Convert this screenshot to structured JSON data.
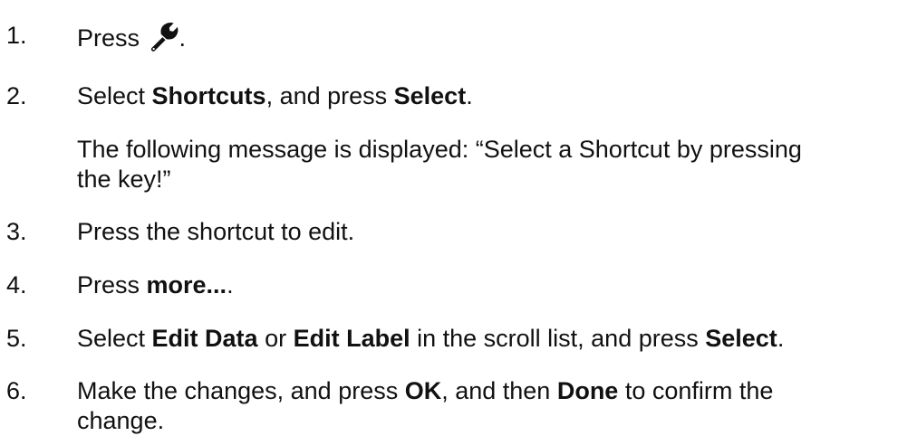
{
  "steps": [
    {
      "number": "1.",
      "before": "Press ",
      "icon": "wrench-icon",
      "after": "."
    },
    {
      "number": "2.",
      "t1": "Select ",
      "b1": "Shortcuts",
      "t2": ", and press ",
      "b2": "Select",
      "t3": "."
    },
    {
      "note_line1": "The following message is displayed: “Select a Shortcut by pressing",
      "note_line2": "the key!”"
    },
    {
      "number": "3.",
      "text": "Press the shortcut to edit."
    },
    {
      "number": "4.",
      "t1": "Press ",
      "b1": "more...",
      "t2": "."
    },
    {
      "number": "5.",
      "t1": "Select ",
      "b1": "Edit Data",
      "t2": " or ",
      "b2": "Edit Label",
      "t3": " in the scroll list, and press ",
      "b3": "Select",
      "t4": "."
    },
    {
      "number": "6.",
      "t1": "Make the changes, and press ",
      "b1": "OK",
      "t2": ", and then ",
      "b2": "Done",
      "t3": " to confirm the",
      "line2": "change."
    }
  ]
}
